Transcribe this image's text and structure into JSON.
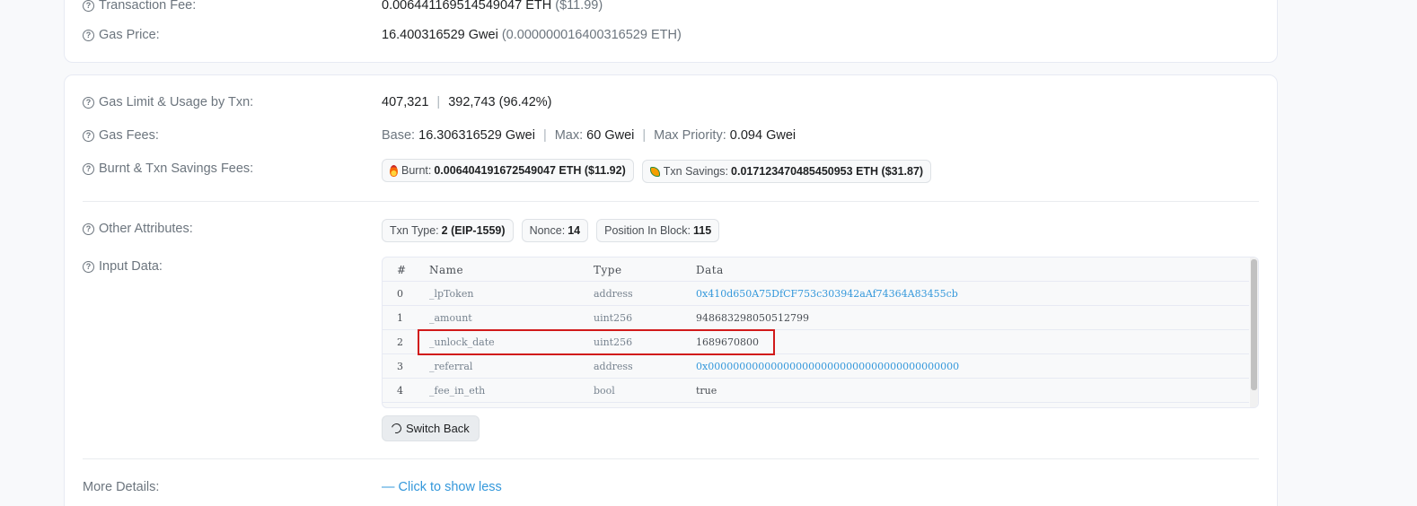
{
  "top_card": {
    "transaction_fee": {
      "label": "Transaction Fee:",
      "value": "0.006441169514549047 ETH",
      "usd": "($11.99)"
    },
    "gas_price": {
      "label": "Gas Price:",
      "value": "16.400316529 Gwei",
      "eth": "(0.000000016400316529 ETH)"
    }
  },
  "gas_limit": {
    "label": "Gas Limit & Usage by Txn:",
    "limit": "407,321",
    "usage": "392,743 (96.42%)"
  },
  "gas_fees": {
    "label": "Gas Fees:",
    "base_label": "Base:",
    "base_value": "16.306316529 Gwei",
    "max_label": "Max:",
    "max_value": "60 Gwei",
    "priority_label": "Max Priority:",
    "priority_value": "0.094 Gwei"
  },
  "burnt_savings": {
    "label": "Burnt & Txn Savings Fees:",
    "burnt_label": "Burnt:",
    "burnt_value": "0.006404191672549047 ETH ($11.92)",
    "savings_label": "Txn Savings:",
    "savings_value": "0.017123470485450953 ETH ($31.87)"
  },
  "other_attributes": {
    "label": "Other Attributes:",
    "txn_type_label": "Txn Type:",
    "txn_type_value": "2 (EIP-1559)",
    "nonce_label": "Nonce:",
    "nonce_value": "14",
    "position_label": "Position In Block:",
    "position_value": "115"
  },
  "input_data": {
    "label": "Input Data:",
    "headers": {
      "idx": "#",
      "name": "Name",
      "type": "Type",
      "data": "Data"
    },
    "rows": [
      {
        "idx": "0",
        "name": "_lpToken",
        "type": "address",
        "data": "0x410d650A75DfCF753c303942aAf74364A83455cb"
      },
      {
        "idx": "1",
        "name": "_amount",
        "type": "uint256",
        "data": "948683298050512799"
      },
      {
        "idx": "2",
        "name": "_unlock_date",
        "type": "uint256",
        "data": "1689670800"
      },
      {
        "idx": "3",
        "name": "_referral",
        "type": "address",
        "data": "0x0000000000000000000000000000000000000000"
      },
      {
        "idx": "4",
        "name": "_fee_in_eth",
        "type": "bool",
        "data": "true"
      }
    ],
    "switch_back_label": "Switch Back"
  },
  "more_details": {
    "label": "More Details:",
    "toggle_label": "— Click to show less"
  },
  "colors": {
    "link": "#3498db",
    "highlight": "#d11a1a",
    "muted": "#6c757e"
  }
}
